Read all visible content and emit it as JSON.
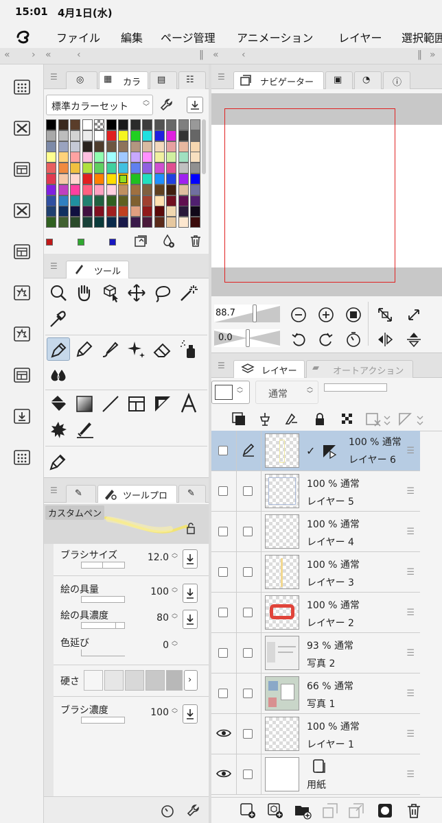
{
  "status": {
    "time": "15:01",
    "date": "4月1日(水)"
  },
  "menu": [
    "ファイル",
    "編集",
    "ページ管理",
    "アニメーション",
    "レイヤー",
    "選択範囲"
  ],
  "color_panel": {
    "tab_label": "カラ",
    "set_name": "標準カラーセット",
    "palette": [
      [
        "#000000",
        "#3b2a1e",
        "#5a3d2a",
        "#ffffff",
        "#checker",
        "#000000",
        "#1a1a1a",
        "#2b2b2b",
        "#3d3d3d",
        "#525252",
        "#686868",
        "#7f7f7f",
        "#999999"
      ],
      [
        "#a9a9a9",
        "#bdbdbd",
        "#d3d3d3",
        "#ececec",
        "#ffffff",
        "#e02020",
        "#f5f520",
        "#20d020",
        "#20e0e0",
        "#2020e0",
        "#e020e0",
        "#333333",
        "#666666"
      ],
      [
        "#7d8aa8",
        "#9aa3bf",
        "#c5c9d6",
        "#2a231d",
        "#4d3c2c",
        "#6d5641",
        "#8e735b",
        "#b39680",
        "#d8bba2",
        "#f3d9bd",
        "#e6a1a1",
        "#e8b8a0",
        "#f6d7b0"
      ],
      [
        "#ffff90",
        "#ffd27a",
        "#ffa2a2",
        "#ffc0e0",
        "#90ffb0",
        "#a0ffff",
        "#a0c8ff",
        "#c8a8ff",
        "#ff90ff",
        "#f0f0a0",
        "#d0f0a0",
        "#a0e0c0",
        "#f8e0c0"
      ],
      [
        "#e86060",
        "#f08a40",
        "#f0c040",
        "#b0e040",
        "#60d060",
        "#40d0a0",
        "#40c0e0",
        "#6080f0",
        "#9060e0",
        "#d050d0",
        "#e05090",
        "#c0c0c0",
        "#909090"
      ],
      [
        "#e03a50",
        "#f6c8a8",
        "#ffd8d0",
        "#e02020",
        "#ff8000",
        "#ffdd00",
        "#90e020",
        "#20c020",
        "#20e0c0",
        "#2090ff",
        "#2040e0",
        "#a020f0",
        "#0000ff"
      ],
      [
        "#8020e0",
        "#c040c0",
        "#ff40a0",
        "#ff6080",
        "#ffa0c0",
        "#ffd0e0",
        "#c09060",
        "#a07040",
        "#806040",
        "#604020",
        "#402010",
        "#e0c0a0",
        "#7070a0"
      ],
      [
        "#3050a0",
        "#3080c0",
        "#2090a0",
        "#208070",
        "#206040",
        "#306020",
        "#606020",
        "#806030",
        "#a04030",
        "#ffe0b0",
        "#701020",
        "#601050",
        "#502070"
      ],
      [
        "#204070",
        "#103060",
        "#101040",
        "#401040",
        "#801020",
        "#a02020",
        "#c04020",
        "#e0a080",
        "#901a1a",
        "#5a0a0a",
        "#f0d8b0",
        "#2a1a3a",
        "#100818"
      ],
      [
        "#306020",
        "#406030",
        "#2a4a2a",
        "#184038",
        "#0a3a3a",
        "#0a2a4a",
        "#1a1a4a",
        "#3a1a4a",
        "#4a1a3a",
        "#5a2a1a",
        "#e6c8a0",
        "#fde7cf",
        "#3a0a0a"
      ]
    ],
    "footer_chips": [
      "#c01818",
      "#30a830",
      "#1818c0"
    ]
  },
  "tool_panel": {
    "tab_label": "ツール"
  },
  "prop_panel": {
    "tab_label": "ツールプロ",
    "tool_name": "カスタムペン",
    "props": [
      {
        "label": "ブラシサイズ",
        "value": "12.0"
      },
      {
        "label": "絵の具量",
        "value": "100"
      },
      {
        "label": "絵の具濃度",
        "value": "80"
      },
      {
        "label": "色延び",
        "value": "0"
      },
      {
        "label": "硬さ",
        "value": ""
      },
      {
        "label": "ブラシ濃度",
        "value": "100"
      }
    ]
  },
  "navigator": {
    "tab_label": "ナビゲーター",
    "zoom": "88.7",
    "angle": "0.0"
  },
  "layer_panel": {
    "tab_label": "レイヤー",
    "tab2_label": "オートアクション",
    "blend_mode": "通常",
    "layers": [
      {
        "top": "100 % 通常",
        "name": "レイヤー 6",
        "selected": true
      },
      {
        "top": "100 % 通常",
        "name": "レイヤー 5"
      },
      {
        "top": "100 % 通常",
        "name": "レイヤー 4"
      },
      {
        "top": "100 % 通常",
        "name": "レイヤー 3"
      },
      {
        "top": "100 % 通常",
        "name": "レイヤー 2"
      },
      {
        "top": "93 % 通常",
        "name": "写真 2"
      },
      {
        "top": "66 % 通常",
        "name": "写真 1"
      },
      {
        "top": "100 % 通常",
        "name": "レイヤー 1"
      },
      {
        "top": "",
        "name": "用紙"
      }
    ]
  },
  "icons": {
    "leftstrip": [
      "material-icon",
      "crossed-icon",
      "layout-icon",
      "crossed-icon",
      "layout-icon",
      "burst-icon",
      "burst-icon",
      "layout-icon",
      "download-icon",
      "material-icon"
    ],
    "tools_row1": [
      "zoom-icon",
      "hand-icon",
      "object-select-icon",
      "move-icon",
      "lasso-icon",
      "magic-wand-icon",
      "eyedropper-icon"
    ],
    "tools_row2": [
      "pen-icon",
      "pencil-icon",
      "brush-icon",
      "sparkle-icon",
      "eraser-icon",
      "spray-icon",
      "blend-icon"
    ],
    "tools_row3": [
      "fill-icon",
      "gradient-icon",
      "line-icon",
      "frame-icon",
      "ruler-icon",
      "text-icon",
      "balloon-icon",
      "correction-icon"
    ],
    "tools_row4": [
      "pen-nib-icon"
    ]
  },
  "accent": {
    "selection": "#b7cce3",
    "nav_frame": "#e02020",
    "selected_swatch": "#e8b400"
  }
}
